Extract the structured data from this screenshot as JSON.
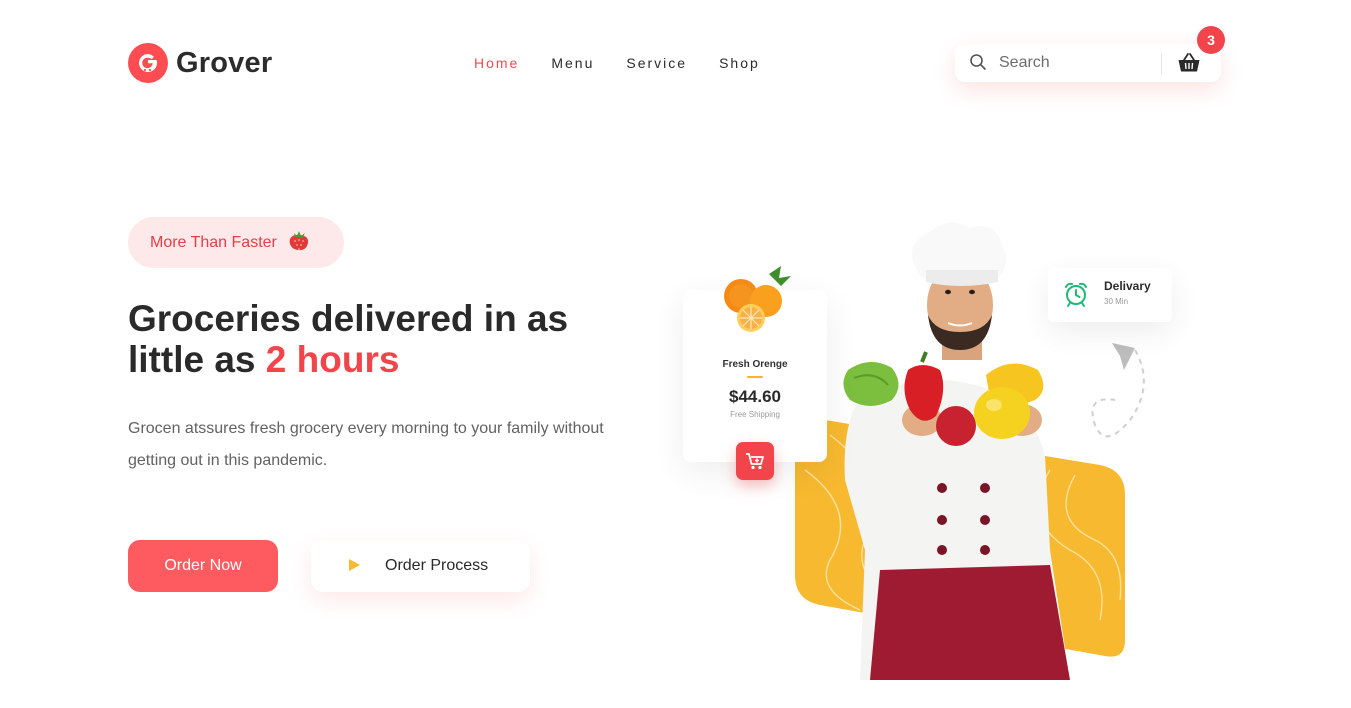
{
  "brand": {
    "name": "Grover",
    "accent": "#f2454b",
    "yellow": "#f7b92f"
  },
  "nav": {
    "items": [
      {
        "label": "Home",
        "active": true
      },
      {
        "label": "Menu",
        "active": false
      },
      {
        "label": "Service",
        "active": false
      },
      {
        "label": "Shop",
        "active": false
      }
    ]
  },
  "search": {
    "placeholder": "Search",
    "icon": "search-icon"
  },
  "cart": {
    "count": "3",
    "icon": "basket-icon"
  },
  "hero": {
    "tag": "More Than Faster",
    "headline_part1": "Groceries delivered in as little as ",
    "headline_highlight": "2 hours",
    "description": "Grocen atssures fresh grocery every morning to your family without getting out in this pandemic.",
    "primary_button": "Order Now",
    "secondary_button": "Order Process"
  },
  "product_card": {
    "name": "Fresh Orenge",
    "price": "$44.60",
    "shipping": "Free Shipping"
  },
  "delivery_card": {
    "title": "Delivary",
    "time": "30 Min"
  }
}
